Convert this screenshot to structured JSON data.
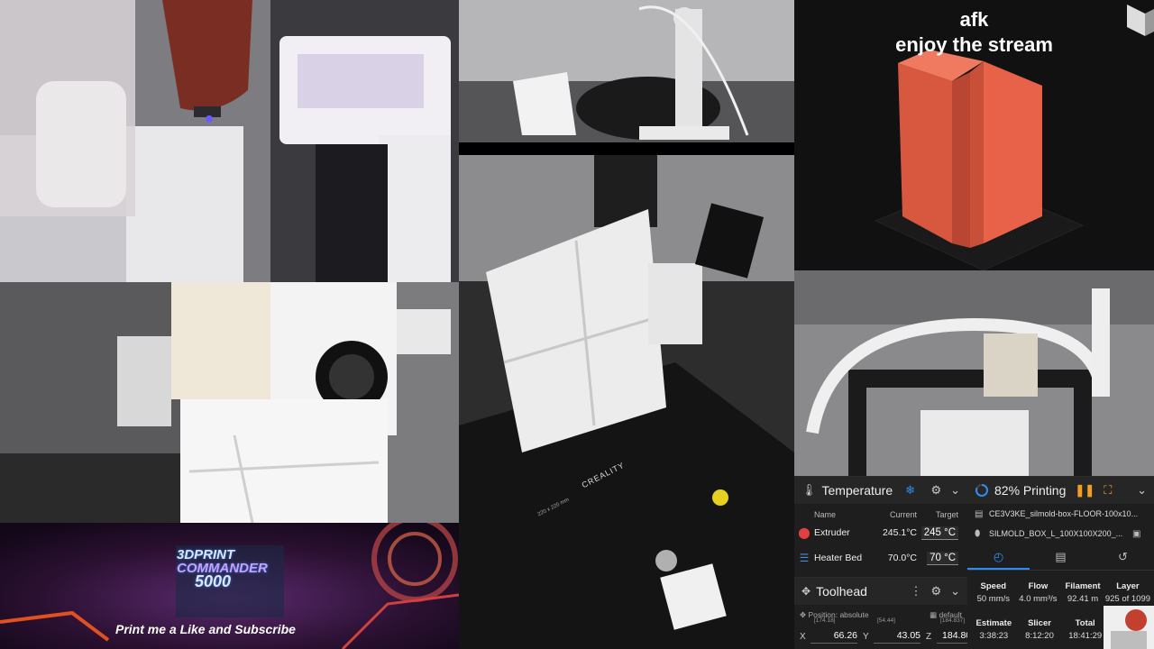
{
  "overlay": {
    "line1": "afk",
    "line2": "enjoy the stream"
  },
  "banner": {
    "logo_line1": "3DPRINT",
    "logo_line2": "COMMANDER",
    "logo_line3": "5000",
    "tagline": "Print me a Like and Subscribe"
  },
  "bed_marking": {
    "brand": "CREALITY",
    "size": "220 x 220 mm"
  },
  "temperature": {
    "title": "Temperature",
    "headers": {
      "name": "Name",
      "current": "Current",
      "target": "Target"
    },
    "rows": [
      {
        "name": "Extruder",
        "current": "245.1°C",
        "target": "245",
        "unit": "°C"
      },
      {
        "name": "Heater Bed",
        "current": "70.0°C",
        "target": "70",
        "unit": "°C"
      }
    ]
  },
  "toolhead": {
    "title": "Toolhead",
    "position_label": "Position: absolute",
    "default_label": "default",
    "axes": [
      {
        "axis": "X",
        "small": "[174.18]",
        "value": "66.26"
      },
      {
        "axis": "Y",
        "small": "[54.44]",
        "value": "43.05"
      },
      {
        "axis": "Z",
        "small": "[184.837]",
        "value": "184.800"
      }
    ]
  },
  "status": {
    "progress_label": "82% Printing",
    "progress": 0.82,
    "file1": "CE3V3KE_silmold-box-FLOOR-100x10...",
    "file2": "SILMOLD_BOX_L_100X100X200_...",
    "stats": [
      {
        "label": "Speed",
        "value": "50 mm/s"
      },
      {
        "label": "Flow",
        "value": "4.0 mm³/s"
      },
      {
        "label": "Filament",
        "value": "92.41 m"
      },
      {
        "label": "Layer",
        "value": "925 of 1099"
      }
    ],
    "times": [
      {
        "label": "Estimate",
        "value": "3:38:23"
      },
      {
        "label": "Slicer",
        "value": "8:12:20"
      },
      {
        "label": "Total",
        "value": "18:41:29"
      }
    ]
  },
  "colors": {
    "accent": "#2f8cf0",
    "pause": "#f0a020",
    "model": "#e8624a",
    "panel": "#1e1e1e"
  }
}
